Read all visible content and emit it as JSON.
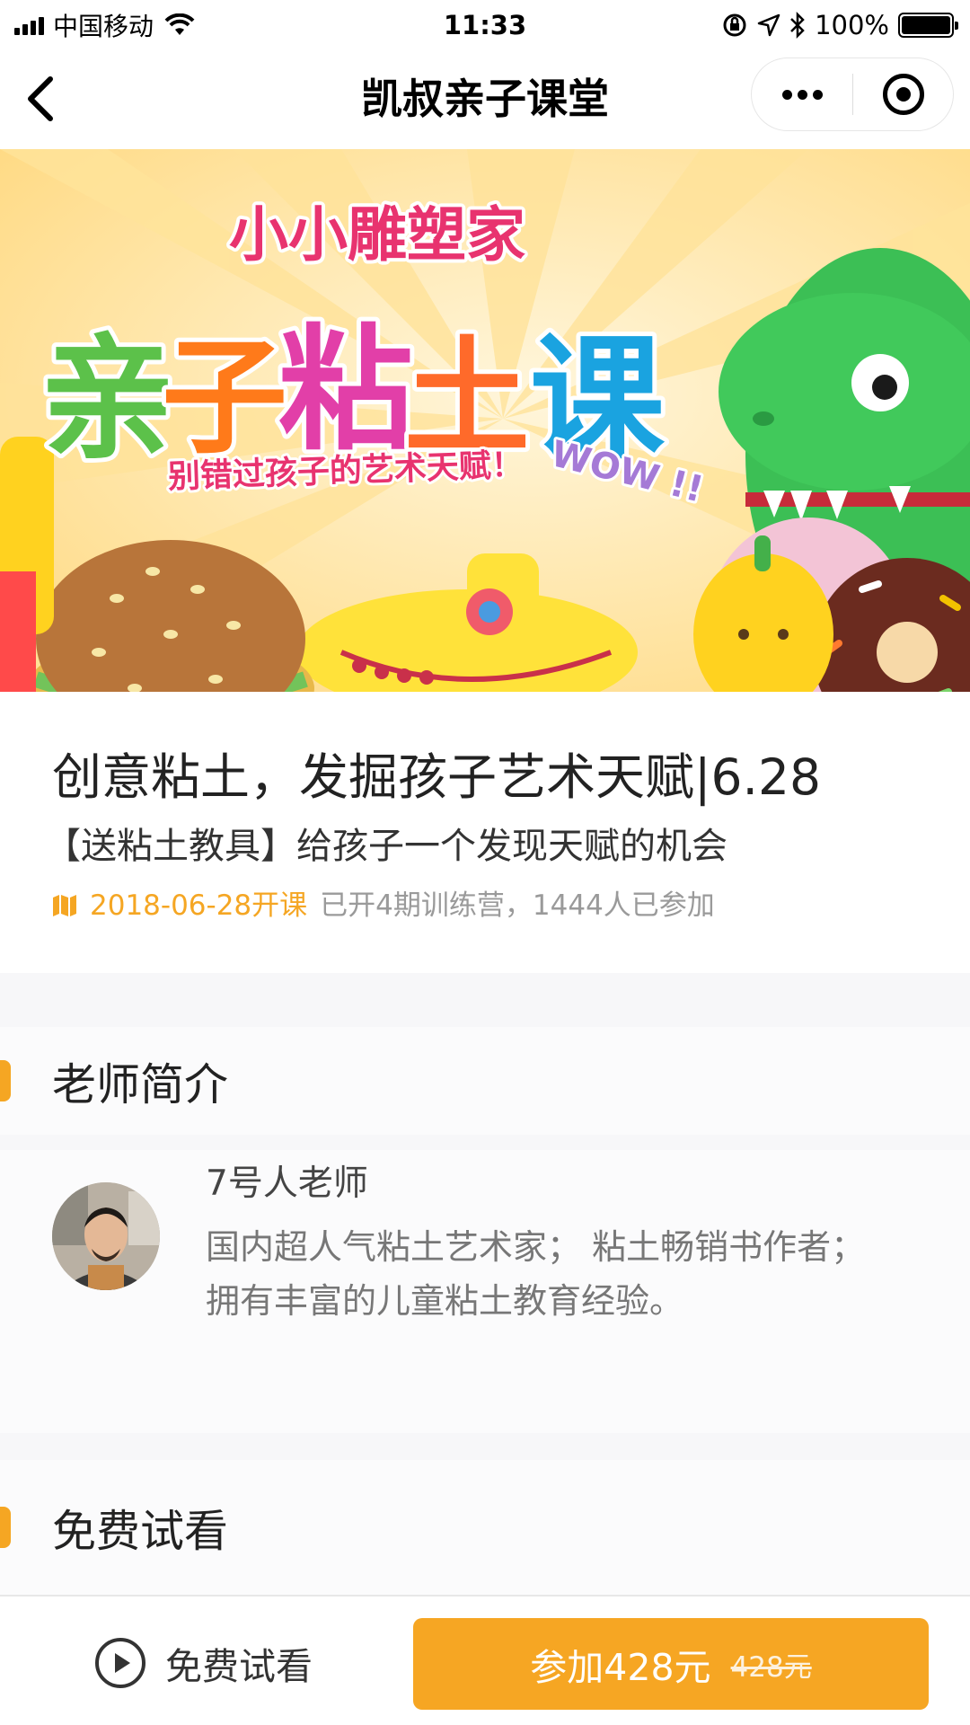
{
  "status_bar": {
    "carrier": "中国移动",
    "time": "11:33",
    "battery": "100%",
    "battery_level": 1.0
  },
  "nav": {
    "title": "凯叔亲子课堂"
  },
  "banner": {
    "headline_small": "小小雕塑家",
    "headline_large": [
      "亲",
      "子",
      "粘",
      "土",
      "课"
    ],
    "tagline": "别错过孩子的艺术天赋！",
    "exclaim": "WOW !!"
  },
  "course": {
    "title": "创意粘土，发掘孩子艺术天赋|6.28",
    "subtitle": "【送粘土教具】给孩子一个发现天赋的机会",
    "start_date": "2018-06-28开课",
    "stats": "已开4期训练营，1444人已参加"
  },
  "teacher_section": {
    "title": "老师简介",
    "name": "7号人老师",
    "bio_line1": "国内超人气粘土艺术家； 粘土畅销书作者；",
    "bio_line2": "拥有丰富的儿童粘土教育经验。"
  },
  "preview_section": {
    "title": "免费试看"
  },
  "bottom_bar": {
    "preview_label": "免费试看",
    "join_label": "参加428元",
    "original_price": "428元"
  },
  "colors": {
    "accent": "#f5a623",
    "button": "#f6a623"
  }
}
